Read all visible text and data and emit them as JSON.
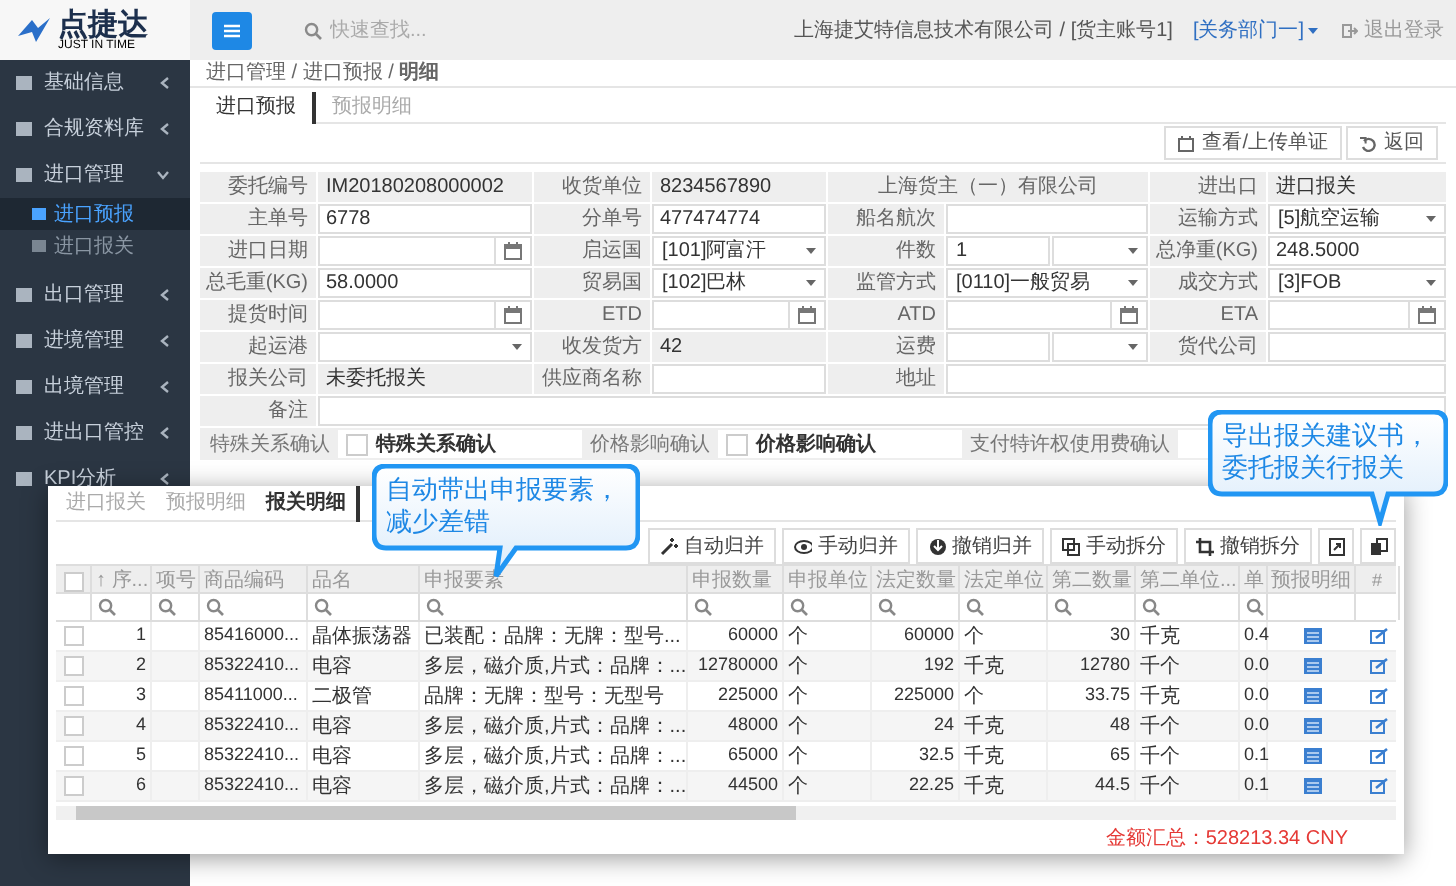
{
  "sidebar": {
    "logo": {
      "name": "点捷达",
      "tagline": "JUST IN TIME"
    },
    "items": [
      {
        "label": "基础信息",
        "expanded": false
      },
      {
        "label": "合规资料库",
        "expanded": false
      },
      {
        "label": "进口管理",
        "expanded": true,
        "children": [
          {
            "label": "进口预报",
            "selected": true
          },
          {
            "label": "进口报关",
            "selected": false
          }
        ]
      },
      {
        "label": "出口管理",
        "expanded": false
      },
      {
        "label": "进境管理",
        "expanded": false
      },
      {
        "label": "出境管理",
        "expanded": false
      },
      {
        "label": "进出口管控",
        "expanded": false
      },
      {
        "label": "KPI分析",
        "expanded": false
      }
    ]
  },
  "header": {
    "search": {
      "placeholder": "快速查找..."
    },
    "account": "上海捷艾特信息技术有限公司 / [货主账号1]",
    "department": "[关务部门一]",
    "logout": "退出登录"
  },
  "breadcrumb": "进口管理 / 进口预报 / **明细**",
  "tabs": [
    {
      "label": "进口预报",
      "selected": true
    },
    {
      "label": "预报明细",
      "selected": false
    }
  ],
  "toolbar": [
    "查看/上传单证",
    "返回"
  ],
  "form": {
    "rows": [
      [
        {
          "label": "委托编号",
          "value": "IM20180208000002",
          "kind": "text",
          "readonly": true
        },
        {
          "label": "收货单位",
          "value": "8234567890",
          "kind": "text",
          "readonly": true
        },
        {
          "value": "上海货主（一）有限公司",
          "kind": "display"
        },
        {
          "label": "进出口",
          "value": "进口报关",
          "kind": "text",
          "readonly": true
        }
      ],
      [
        {
          "label": "主单号",
          "value": "6778",
          "kind": "text",
          "readonly": false
        },
        {
          "label": "分单号",
          "value": "477474774",
          "kind": "text",
          "readonly": false
        },
        {
          "label": "船名航次",
          "kind": "text",
          "readonly": false
        },
        {
          "label": "运输方式",
          "value": "[5]航空运输",
          "kind": "select"
        }
      ],
      [
        {
          "label": "进口日期",
          "kind": "date"
        },
        {
          "label": "启运国",
          "value": "[101]阿富汗",
          "kind": "select"
        },
        {
          "label": "件数",
          "value": "1",
          "kind": "combo"
        },
        {
          "label": "总净重(KG)",
          "value": "248.5000",
          "kind": "text",
          "readonly": false
        }
      ],
      [
        {
          "label": "总毛重(KG)",
          "value": "58.0000",
          "kind": "text",
          "readonly": false
        },
        {
          "label": "贸易国",
          "value": "[102]巴林",
          "kind": "select"
        },
        {
          "label": "监管方式",
          "value": "[0110]一般贸易",
          "kind": "select"
        },
        {
          "label": "成交方式",
          "value": "[3]FOB",
          "kind": "select"
        }
      ],
      [
        {
          "label": "提货时间",
          "kind": "date"
        },
        {
          "label": "ETD",
          "kind": "date"
        },
        {
          "label": "ATD",
          "kind": "date"
        },
        {
          "label": "ETA",
          "kind": "date"
        }
      ],
      [
        {
          "label": "起运港",
          "kind": "select"
        },
        {
          "label": "收发货方",
          "value": "42",
          "kind": "text",
          "readonly": true
        },
        {
          "label": "运费",
          "kind": "combo"
        },
        {
          "label": "货代公司",
          "kind": "text",
          "readonly": false
        }
      ],
      [
        {
          "label": "报关公司",
          "value": "未委托报关",
          "kind": "text",
          "readonly": true
        },
        {
          "label": "供应商名称",
          "kind": "text",
          "readonly": false
        },
        {
          "label": "地址",
          "kind": "text",
          "readonly": false
        }
      ],
      [
        {
          "label": "备注",
          "kind": "text",
          "readonly": false
        }
      ]
    ],
    "confirmations": [
      {
        "label": "特殊关系确认",
        "checked": false,
        "text": "特殊关系确认"
      },
      {
        "label": "价格影响确认",
        "checked": false,
        "text": "价格影响确认"
      },
      {
        "label": "支付特许权使用费确认"
      }
    ]
  },
  "detail_panel": {
    "tabs": [
      {
        "label": "进口报关",
        "selected": false
      },
      {
        "label": "预报明细",
        "selected": false
      },
      {
        "label": "报关明细",
        "selected": true
      }
    ],
    "toolbar": [
      "自动归并",
      "手动归并",
      "撤销归并",
      "手动拆分",
      "撤销拆分"
    ],
    "table": {
      "header_checked": false,
      "columns": [
        {
          "label": "↑ 序...",
          "filterable": true
        },
        {
          "label": "项号",
          "filterable": true
        },
        {
          "label": "商品编码",
          "filterable": true
        },
        {
          "label": "品名",
          "filterable": true
        },
        {
          "label": "申报要素",
          "filterable": true
        },
        {
          "label": "申报数量",
          "filterable": true
        },
        {
          "label": "申报单位",
          "filterable": true
        },
        {
          "label": "法定数量",
          "filterable": true
        },
        {
          "label": "法定单位",
          "filterable": true
        },
        {
          "label": "第二数量",
          "filterable": true
        },
        {
          "label": "第二单位...",
          "filterable": true
        },
        {
          "label": "单",
          "filterable": true
        },
        {
          "label": "预报明细",
          "filterable": false
        },
        {
          "label": "#",
          "filterable": false
        }
      ],
      "rows": [
        {
          "selected": false,
          "seq": "1",
          "hs_code": "85416000...",
          "name": "晶体振荡器",
          "elements": "已装配：品牌：无牌：型号...",
          "decl_qty": "60000",
          "decl_unit": "个",
          "legal_qty": "60000",
          "legal_unit": "个",
          "second_qty": "30",
          "second_unit": "千克",
          "price": "0.4"
        },
        {
          "selected": false,
          "seq": "2",
          "hs_code": "85322410...",
          "name": "电容",
          "elements": "多层，磁介质,片式：品牌：...",
          "decl_qty": "12780000",
          "decl_unit": "个",
          "legal_qty": "192",
          "legal_unit": "千克",
          "second_qty": "12780",
          "second_unit": "千个",
          "price": "0.0"
        },
        {
          "selected": false,
          "seq": "3",
          "hs_code": "85411000...",
          "name": "二极管",
          "elements": "品牌：无牌：型号：无型号",
          "decl_qty": "225000",
          "decl_unit": "个",
          "legal_qty": "225000",
          "legal_unit": "个",
          "second_qty": "33.75",
          "second_unit": "千克",
          "price": "0.0"
        },
        {
          "selected": false,
          "seq": "4",
          "hs_code": "85322410...",
          "name": "电容",
          "elements": "多层，磁介质,片式：品牌：...",
          "decl_qty": "48000",
          "decl_unit": "个",
          "legal_qty": "24",
          "legal_unit": "千克",
          "second_qty": "48",
          "second_unit": "千个",
          "price": "0.0"
        },
        {
          "selected": false,
          "seq": "5",
          "hs_code": "85322410...",
          "name": "电容",
          "elements": "多层，磁介质,片式：品牌：...",
          "decl_qty": "65000",
          "decl_unit": "个",
          "legal_qty": "32.5",
          "legal_unit": "千克",
          "second_qty": "65",
          "second_unit": "千个",
          "price": "0.1"
        },
        {
          "selected": false,
          "seq": "6",
          "hs_code": "85322410...",
          "name": "电容",
          "elements": "多层，磁介质,片式：品牌：...",
          "decl_qty": "44500",
          "decl_unit": "个",
          "legal_qty": "22.25",
          "legal_unit": "千克",
          "second_qty": "44.5",
          "second_unit": "千个",
          "price": "0.1"
        }
      ]
    },
    "total": "金额汇总：528213.34 CNY"
  },
  "callouts": [
    {
      "text": "自动带出申报要素，减少差错"
    },
    {
      "text": "导出报关建议书，委托报关行报关"
    }
  ]
}
